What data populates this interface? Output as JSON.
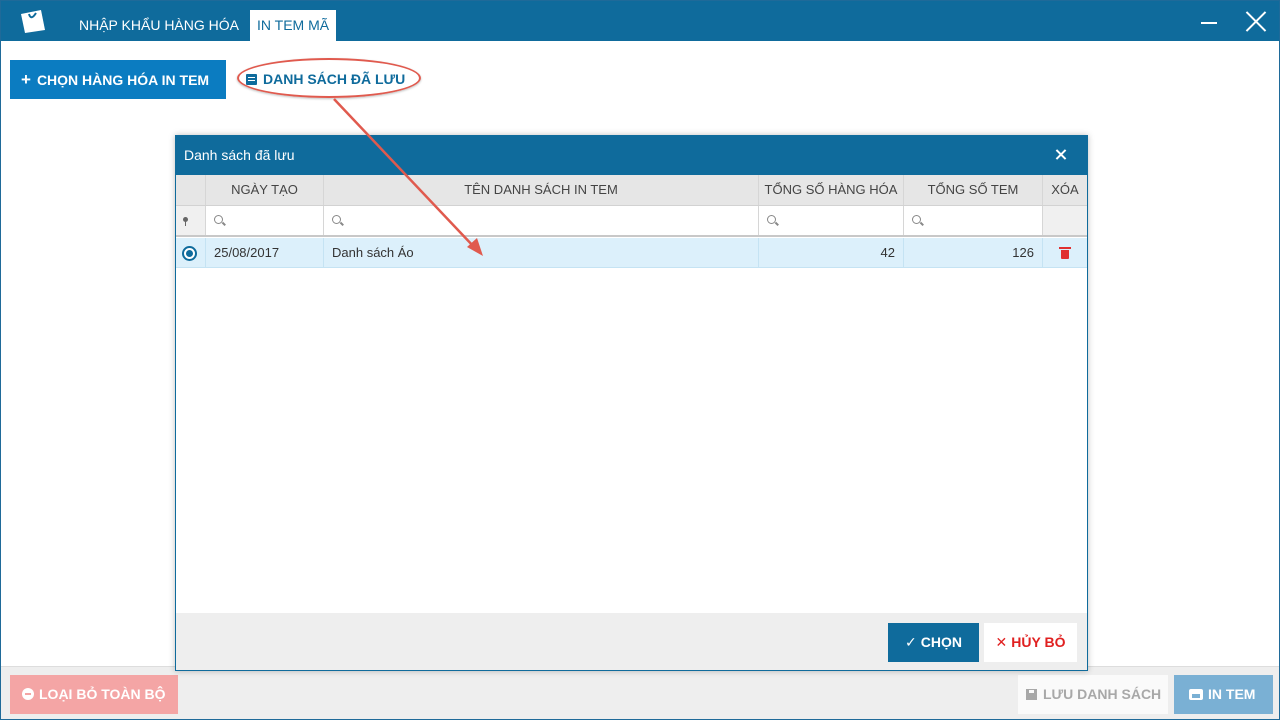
{
  "window": {
    "tabs": [
      {
        "label": "NHẬP KHẨU HÀNG HÓA"
      },
      {
        "label": "IN TEM MÃ"
      }
    ]
  },
  "toolbar": {
    "choose_label": "CHỌN HÀNG HÓA IN TEM",
    "saved_list_label": "DANH SÁCH ĐÃ LƯU"
  },
  "footer": {
    "remove_all_label": "LOẠI BỎ TOÀN BỘ",
    "save_list_label": "LƯU DANH SÁCH",
    "print_label": "IN TEM"
  },
  "dialog": {
    "title": "Danh sách đã lưu",
    "columns": [
      "NGÀY TẠO",
      "TÊN DANH SÁCH IN TEM",
      "TỔNG SỐ HÀNG HÓA",
      "TỔNG SỐ TEM",
      "XÓA"
    ],
    "rows": [
      {
        "date": "25/08/2017",
        "name": "Danh sách Áo",
        "total_items": "42",
        "total_labels": "126",
        "selected": true
      }
    ],
    "ok_label": "CHỌN",
    "cancel_label": "HỦY BỎ"
  },
  "colors": {
    "brand": "#0f6b9c",
    "primary_button": "#0b7cc1",
    "danger": "#e02020",
    "annotation": "#e05a4e"
  }
}
